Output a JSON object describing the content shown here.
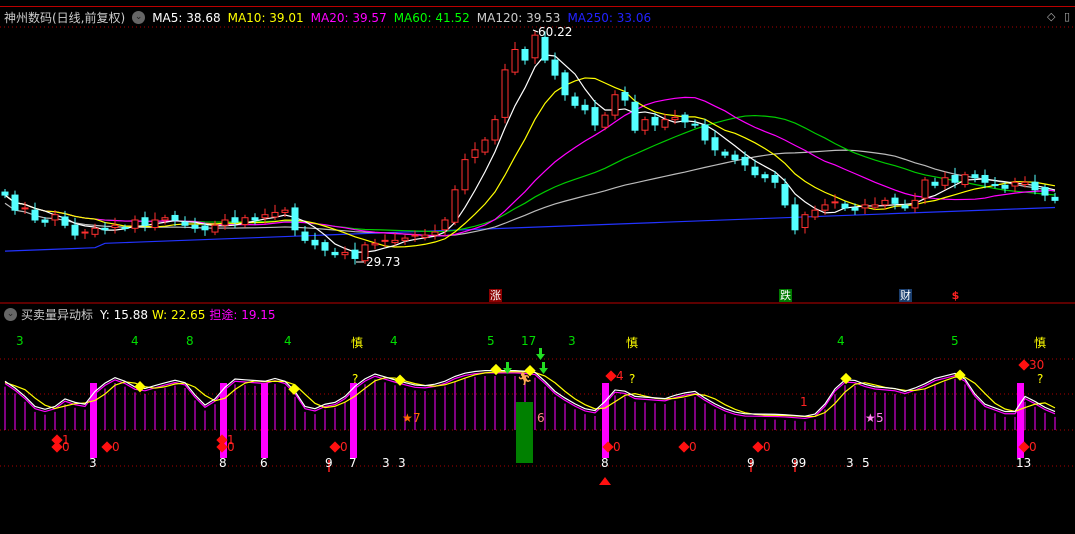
{
  "main": {
    "title": "神州数码(日线,前复权)",
    "ma": [
      {
        "label": "MA5: 38.68",
        "color": "#ffffff"
      },
      {
        "label": "MA10: 39.01",
        "color": "#ffff00"
      },
      {
        "label": "MA20: 39.57",
        "color": "#ff00ff"
      },
      {
        "label": "MA60: 41.52",
        "color": "#00ff00"
      },
      {
        "label": "MA120: 39.53",
        "color": "#cccccc"
      },
      {
        "label": "MA250: 33.06",
        "color": "#2222ff"
      }
    ],
    "high_label": "60.22",
    "low_label": "29.73",
    "events": [
      {
        "label": "涨",
        "bar": 49,
        "bg": "#8b0000"
      },
      {
        "label": "跌",
        "bar": 78,
        "bg": "#007a00"
      },
      {
        "label": "财",
        "bar": 90,
        "bg": "#1a3e6e"
      },
      {
        "label": "$",
        "bar": 95,
        "bg": "#000000"
      }
    ]
  },
  "indicator": {
    "title": "买卖量异动标",
    "y_label": "Y: 15.88",
    "w_label": "W: 22.65",
    "d_label": "担途: 19.15"
  },
  "chart_data": {
    "type": "candlestick",
    "price_range": [
      29.73,
      60.22
    ],
    "closes": [
      38.6,
      36.6,
      36.9,
      35.3,
      35.0,
      36.0,
      34.6,
      33.3,
      33.7,
      34.2,
      34.0,
      34.6,
      34.2,
      35.3,
      34.6,
      35.3,
      35.6,
      35.3,
      34.6,
      34.2,
      34.0,
      34.6,
      35.3,
      35.0,
      35.6,
      35.3,
      36.0,
      36.3,
      36.6,
      34.0,
      32.6,
      32.0,
      31.3,
      30.7,
      31.0,
      30.2,
      32.0,
      32.2,
      32.6,
      32.6,
      32.9,
      33.3,
      33.3,
      33.7,
      35.3,
      39.3,
      43.3,
      44.6,
      45.9,
      48.6,
      55.2,
      57.9,
      56.5,
      59.8,
      56.5,
      54.5,
      51.9,
      50.5,
      49.9,
      47.9,
      49.2,
      51.9,
      51.2,
      47.2,
      48.6,
      47.9,
      48.6,
      48.9,
      48.3,
      47.9,
      45.9,
      44.6,
      43.9,
      43.3,
      42.6,
      41.3,
      40.9,
      40.3,
      37.3,
      34.0,
      36.0,
      36.6,
      37.3,
      37.7,
      36.9,
      36.6,
      37.3,
      37.3,
      37.9,
      37.5,
      36.9,
      37.9,
      40.6,
      39.9,
      40.9,
      40.3,
      41.3,
      40.9,
      40.3,
      39.9,
      39.5,
      40.3,
      40.3,
      39.3,
      38.6,
      37.9
    ],
    "oscillator": [
      [
        0,
        81
      ],
      [
        1.5,
        63
      ],
      [
        3,
        36
      ],
      [
        4,
        31
      ],
      [
        5,
        36
      ],
      [
        5.5,
        54
      ],
      [
        6.5,
        45
      ],
      [
        8,
        40
      ],
      [
        9,
        63
      ],
      [
        10.5,
        85
      ],
      [
        11.5,
        90
      ],
      [
        12.5,
        72
      ],
      [
        14,
        68
      ],
      [
        15.5,
        76
      ],
      [
        17.5,
        85
      ],
      [
        18.5,
        72
      ],
      [
        19.5,
        41
      ],
      [
        20.5,
        36
      ],
      [
        21.5,
        63
      ],
      [
        23,
        85
      ],
      [
        26,
        81
      ],
      [
        27,
        86
      ],
      [
        28,
        81
      ],
      [
        29,
        63
      ],
      [
        30,
        36
      ],
      [
        31,
        32
      ],
      [
        32,
        40
      ],
      [
        33.5,
        45
      ],
      [
        34.5,
        63
      ],
      [
        35.5,
        81
      ],
      [
        37,
        94
      ],
      [
        38.5,
        86
      ],
      [
        39.5,
        81
      ],
      [
        41.5,
        72
      ],
      [
        43.5,
        77
      ],
      [
        45.5,
        94
      ],
      [
        47.5,
        100
      ],
      [
        51.5,
        100
      ],
      [
        53,
        97
      ],
      [
        54,
        81
      ],
      [
        55,
        63
      ],
      [
        56.5,
        45
      ],
      [
        58,
        32
      ],
      [
        59.5,
        27
      ],
      [
        60.5,
        63
      ],
      [
        61.5,
        68
      ],
      [
        63,
        54
      ],
      [
        66,
        50
      ],
      [
        67.5,
        59
      ],
      [
        69,
        63
      ],
      [
        70.5,
        45
      ],
      [
        72,
        32
      ],
      [
        73.5,
        23
      ],
      [
        77.5,
        22
      ],
      [
        80.5,
        18
      ],
      [
        81.5,
        27
      ],
      [
        82.5,
        54
      ],
      [
        83.5,
        81
      ],
      [
        84.5,
        86
      ],
      [
        86.5,
        72
      ],
      [
        89,
        68
      ],
      [
        90,
        63
      ],
      [
        91.5,
        72
      ],
      [
        93,
        86
      ],
      [
        95,
        95
      ],
      [
        96,
        85
      ],
      [
        97,
        58
      ],
      [
        98,
        40
      ],
      [
        100,
        27
      ],
      [
        101,
        27
      ],
      [
        102,
        54
      ],
      [
        103,
        45
      ],
      [
        104.7,
        27
      ]
    ],
    "top_labels": [
      {
        "bar": 1.5,
        "text": "3",
        "color": "#00dd00"
      },
      {
        "bar": 13,
        "text": "4",
        "color": "#00dd00"
      },
      {
        "bar": 18.5,
        "text": "8",
        "color": "#00dd00"
      },
      {
        "bar": 28.3,
        "text": "4",
        "color": "#00dd00"
      },
      {
        "bar": 35,
        "text": "慎",
        "color": "#ffff00"
      },
      {
        "bar": 38.9,
        "text": "4",
        "color": "#00dd00"
      },
      {
        "bar": 48.6,
        "text": "5",
        "color": "#00dd00"
      },
      {
        "bar": 52,
        "text": "17",
        "color": "#00dd00"
      },
      {
        "bar": 56.7,
        "text": "3",
        "color": "#00dd00"
      },
      {
        "bar": 62.5,
        "text": "慎",
        "color": "#ffff00"
      },
      {
        "bar": 83.6,
        "text": "4",
        "color": "#00dd00"
      },
      {
        "bar": 95,
        "text": "5",
        "color": "#00dd00"
      },
      {
        "bar": 103.3,
        "text": "慎",
        "color": "#ffff00"
      }
    ],
    "volume_spikes": [
      {
        "bar": 8.8,
        "text": "3"
      },
      {
        "bar": 21.8,
        "text": "8"
      },
      {
        "bar": 25.9,
        "text": "6"
      },
      {
        "bar": 34.8,
        "text": "7"
      },
      {
        "bar": 60,
        "text": "8"
      },
      {
        "bar": 101.5,
        "text": "13"
      }
    ],
    "bottom_numbers": [
      {
        "bar": 32.4,
        "text": "9",
        "arrow": true
      },
      {
        "bar": 38.1,
        "text": "3"
      },
      {
        "bar": 39.7,
        "text": "3"
      },
      {
        "bar": 74.6,
        "text": "9",
        "arrow": true
      },
      {
        "bar": 79,
        "text": "99",
        "arrow": true
      },
      {
        "bar": 84.5,
        "text": "3"
      },
      {
        "bar": 86.1,
        "text": "5"
      }
    ],
    "red_diamonds": [
      {
        "bar": 5.2,
        "text": "1",
        "level": "mid2"
      },
      {
        "bar": 5.2,
        "text": "0",
        "level": "mid"
      },
      {
        "bar": 10.2,
        "text": "0",
        "level": "mid"
      },
      {
        "bar": 21.7,
        "text": "1",
        "level": "mid2"
      },
      {
        "bar": 21.7,
        "text": "0",
        "level": "mid"
      },
      {
        "bar": 33,
        "text": "0",
        "level": "mid"
      },
      {
        "bar": 60.3,
        "text": "0",
        "level": "mid"
      },
      {
        "bar": 67.9,
        "text": "0",
        "level": "mid"
      },
      {
        "bar": 75.3,
        "text": "0",
        "level": "mid"
      },
      {
        "bar": 101.9,
        "text": "0",
        "level": "mid"
      },
      {
        "bar": 60.6,
        "text": "4",
        "level": "high"
      },
      {
        "bar": 101.9,
        "text": "30",
        "level": "top"
      }
    ],
    "yellow_diamonds": [
      13.5,
      28.9,
      39.5,
      49.1,
      52.5,
      84.1,
      95.5
    ],
    "green_arrows": [
      50.2,
      53.5,
      53.8
    ],
    "question_marks": [
      35,
      62.7,
      103.5
    ],
    "stars": [
      {
        "bar": 40.3,
        "text": "7",
        "color": "#ff6a00"
      },
      {
        "bar": 86.6,
        "text": "5",
        "color": "#ff88ee"
      }
    ],
    "extra_labels": [
      {
        "bar": 53.5,
        "text": "6"
      },
      {
        "bar": 79.8,
        "text": "1"
      }
    ]
  }
}
